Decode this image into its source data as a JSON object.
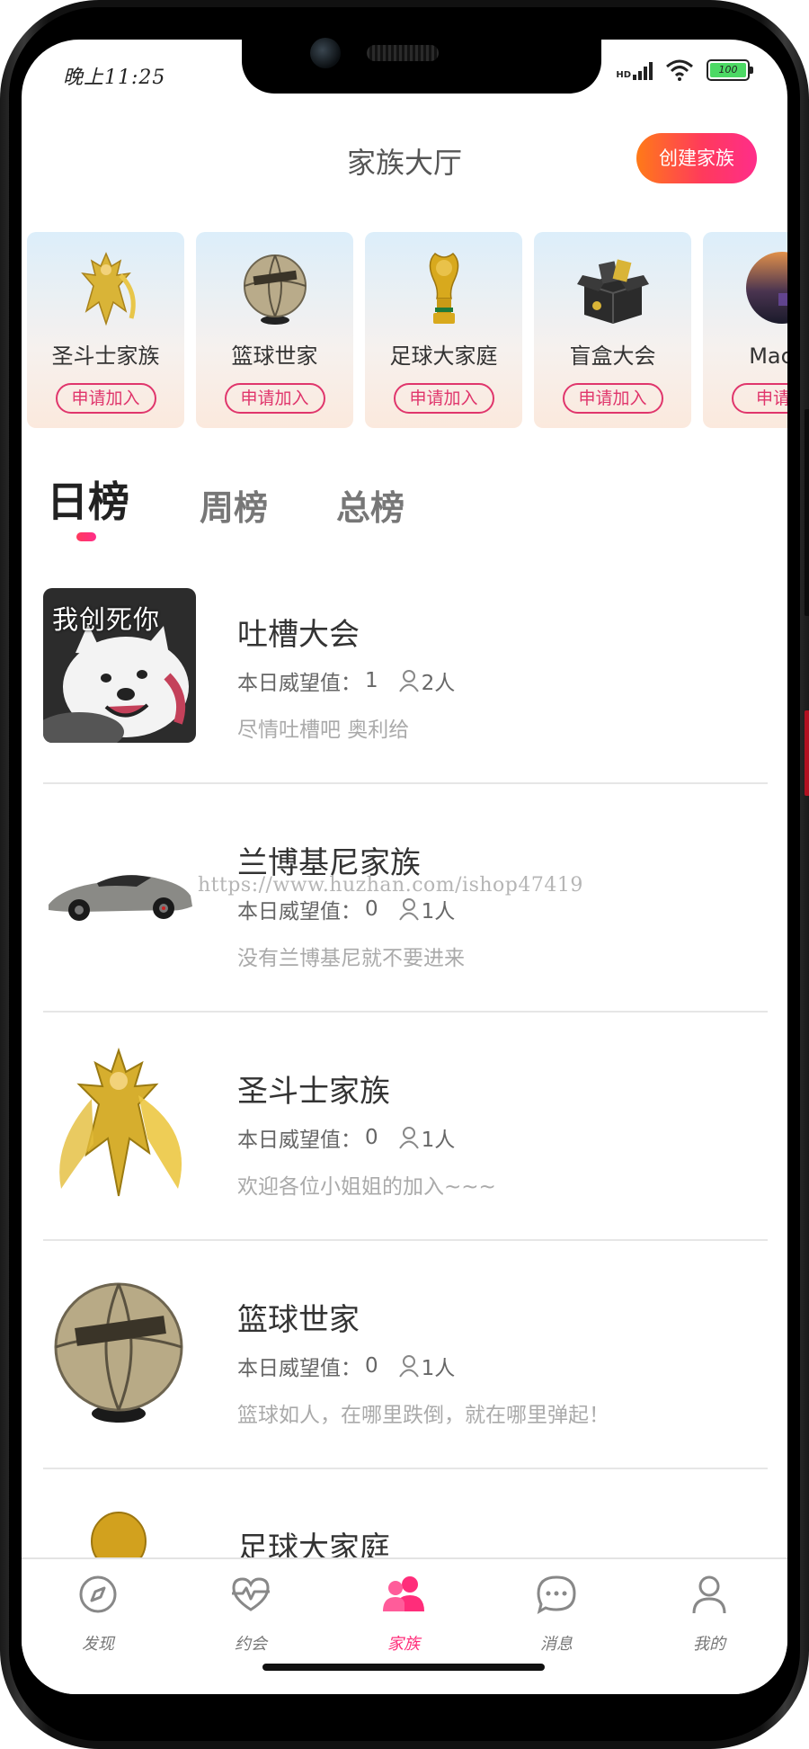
{
  "status_bar": {
    "time": "晚上11:25",
    "network": "HD",
    "battery": "100"
  },
  "header": {
    "title": "家族大厅",
    "create_button": "创建家族"
  },
  "family_cards": [
    {
      "name": "圣斗士家族",
      "join": "申请加入",
      "icon": "saint-warrior-figure"
    },
    {
      "name": "篮球世家",
      "join": "申请加入",
      "icon": "basketball"
    },
    {
      "name": "足球大家庭",
      "join": "申请加入",
      "icon": "world-cup-trophy"
    },
    {
      "name": "盲盒大会",
      "join": "申请加入",
      "icon": "mystery-box"
    },
    {
      "name": "Mac家",
      "join": "申请加",
      "icon": "mac-wallpaper"
    }
  ],
  "ranking_tabs": {
    "active": "日榜",
    "tabs": [
      "日榜",
      "周榜",
      "总榜"
    ]
  },
  "list": [
    {
      "name": "吐槽大会",
      "prestige_label": "本日威望值：",
      "prestige": "1",
      "members": "2人",
      "desc": "尽情吐槽吧 奥利给",
      "avatar_text": "我创死你"
    },
    {
      "name": "兰博基尼家族",
      "prestige_label": "本日威望值：",
      "prestige": "0",
      "members": "1人",
      "desc": "没有兰博基尼就不要进来"
    },
    {
      "name": "圣斗士家族",
      "prestige_label": "本日威望值：",
      "prestige": "0",
      "members": "1人",
      "desc": "欢迎各位小姐姐的加入~~~"
    },
    {
      "name": "篮球世家",
      "prestige_label": "本日威望值：",
      "prestige": "0",
      "members": "1人",
      "desc": "篮球如人，在哪里跌倒，就在哪里弹起！"
    },
    {
      "name": "足球大家庭"
    }
  ],
  "watermark": "https://www.huzhan.com/ishop47419",
  "bottom_nav": [
    {
      "label": "发现",
      "icon": "compass-icon"
    },
    {
      "label": "约会",
      "icon": "heartbeat-icon"
    },
    {
      "label": "家族",
      "icon": "people-icon",
      "active": true
    },
    {
      "label": "消息",
      "icon": "chat-bubble-icon"
    },
    {
      "label": "我的",
      "icon": "user-icon"
    }
  ],
  "colors": {
    "accent": "#ff2d7a",
    "create_gradient": [
      "#ff7a18",
      "#ff2d8a"
    ],
    "join_border": "#e0366c"
  }
}
